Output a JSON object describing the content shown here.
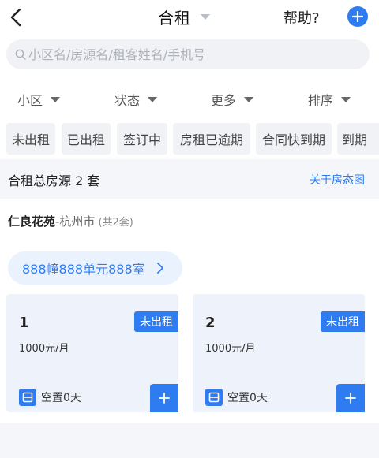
{
  "header": {
    "title": "合租",
    "help_label": "帮助?",
    "back_icon": "back-arrow-icon",
    "add_icon": "plus-circle-icon"
  },
  "search": {
    "placeholder": "小区名/房源名/租客姓名/手机号"
  },
  "filters": [
    {
      "label": "小区"
    },
    {
      "label": "状态"
    },
    {
      "label": "更多"
    },
    {
      "label": "排序"
    }
  ],
  "chips": [
    {
      "label": "未出租"
    },
    {
      "label": "已出租"
    },
    {
      "label": "签订中"
    },
    {
      "label": "房租已逾期"
    },
    {
      "label": "合同快到期"
    },
    {
      "label": "到期"
    }
  ],
  "summary": {
    "text": "合租总房源 2 套",
    "link": "关于房态图"
  },
  "community": {
    "name": "仁良花苑",
    "city": "-杭州市",
    "count": "(共2套)"
  },
  "unit": {
    "label": "888幢888单元888室"
  },
  "rooms": [
    {
      "number": "1",
      "status": "未出租",
      "price": "1000元/月",
      "vacancy": "空置0天"
    },
    {
      "number": "2",
      "status": "未出租",
      "price": "1000元/月",
      "vacancy": "空置0天"
    }
  ],
  "colors": {
    "accent": "#2f7bf0",
    "card_bg": "#eef3fb",
    "pill_bg": "#eaf2fd"
  }
}
